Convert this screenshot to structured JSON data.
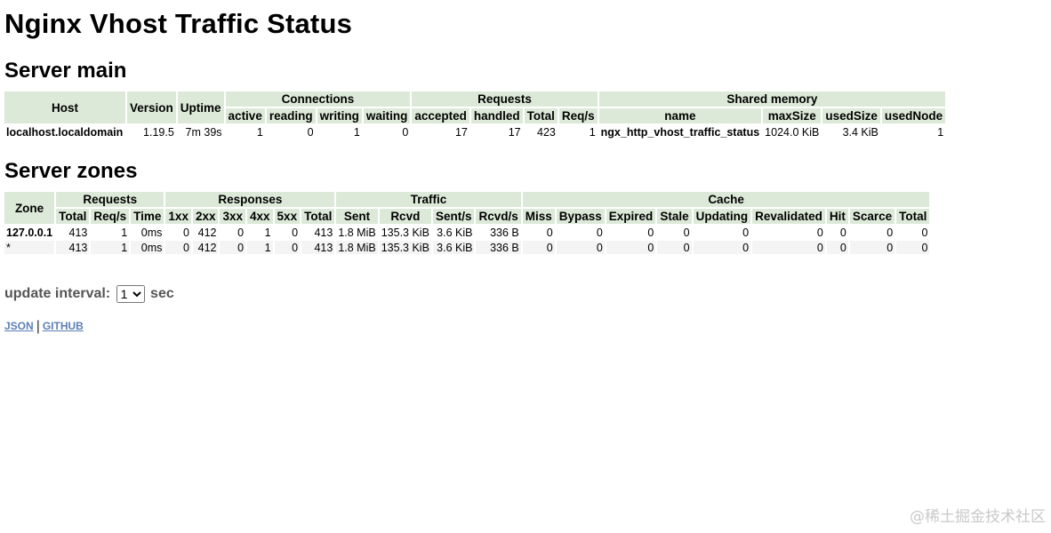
{
  "title": "Nginx Vhost Traffic Status",
  "server_main": {
    "heading": "Server main",
    "headers": {
      "host": "Host",
      "version": "Version",
      "uptime": "Uptime",
      "connections": "Connections",
      "requests": "Requests",
      "shared_memory": "Shared memory",
      "active": "active",
      "reading": "reading",
      "writing": "writing",
      "waiting": "waiting",
      "accepted": "accepted",
      "handled": "handled",
      "total": "Total",
      "req_s": "Req/s",
      "name": "name",
      "max_size": "maxSize",
      "used_size": "usedSize",
      "used_node": "usedNode"
    },
    "row": {
      "host": "localhost.localdomain",
      "version": "1.19.5",
      "uptime": "7m 39s",
      "active": "1",
      "reading": "0",
      "writing": "1",
      "waiting": "0",
      "accepted": "17",
      "handled": "17",
      "total": "423",
      "req_s": "1",
      "name": "ngx_http_vhost_traffic_status",
      "max_size": "1024.0 KiB",
      "used_size": "3.4 KiB",
      "used_node": "1"
    }
  },
  "server_zones": {
    "heading": "Server zones",
    "headers": {
      "zone": "Zone",
      "requests": "Requests",
      "responses": "Responses",
      "traffic": "Traffic",
      "cache": "Cache",
      "total": "Total",
      "req_s": "Req/s",
      "time": "Time",
      "r1xx": "1xx",
      "r2xx": "2xx",
      "r3xx": "3xx",
      "r4xx": "4xx",
      "r5xx": "5xx",
      "rtotal": "Total",
      "sent": "Sent",
      "rcvd": "Rcvd",
      "sent_s": "Sent/s",
      "rcvd_s": "Rcvd/s",
      "miss": "Miss",
      "bypass": "Bypass",
      "expired": "Expired",
      "stale": "Stale",
      "updating": "Updating",
      "revalidated": "Revalidated",
      "hit": "Hit",
      "scarce": "Scarce",
      "ctotal": "Total"
    },
    "rows": [
      {
        "zone": "127.0.0.1",
        "total": "413",
        "req_s": "1",
        "time": "0ms",
        "r1xx": "0",
        "r2xx": "412",
        "r3xx": "0",
        "r4xx": "1",
        "r5xx": "0",
        "rtotal": "413",
        "sent": "1.8 MiB",
        "rcvd": "135.3 KiB",
        "sent_s": "3.6 KiB",
        "rcvd_s": "336 B",
        "miss": "0",
        "bypass": "0",
        "expired": "0",
        "stale": "0",
        "updating": "0",
        "revalidated": "0",
        "hit": "0",
        "scarce": "0",
        "ctotal": "0"
      },
      {
        "zone": "*",
        "total": "413",
        "req_s": "1",
        "time": "0ms",
        "r1xx": "0",
        "r2xx": "412",
        "r3xx": "0",
        "r4xx": "1",
        "r5xx": "0",
        "rtotal": "413",
        "sent": "1.8 MiB",
        "rcvd": "135.3 KiB",
        "sent_s": "3.6 KiB",
        "rcvd_s": "336 B",
        "miss": "0",
        "bypass": "0",
        "expired": "0",
        "stale": "0",
        "updating": "0",
        "revalidated": "0",
        "hit": "0",
        "scarce": "0",
        "ctotal": "0"
      }
    ]
  },
  "update_interval": {
    "label": "update interval:",
    "selected": "1",
    "unit": "sec"
  },
  "links": {
    "json": "JSON",
    "github": "GITHUB",
    "separator": "|"
  },
  "watermark": "@稀土掘金技术社区",
  "colors": {
    "header_bg": "#dde9d8",
    "row_alt_bg": "#f4f4f4",
    "link": "#5c7fb6"
  }
}
